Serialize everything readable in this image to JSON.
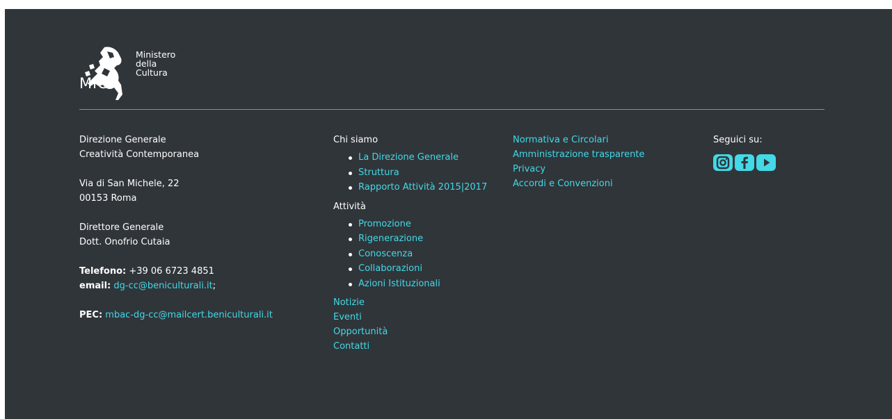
{
  "logo": {
    "abbr": "MiC",
    "words": [
      "Ministero",
      "della",
      "Cultura"
    ]
  },
  "contact": {
    "org_line1": "Direzione Generale",
    "org_line2": "Creatività Contemporanea",
    "address_line1": "Via di San Michele, 22",
    "address_line2": "00153 Roma",
    "director_title": "Direttore Generale",
    "director_name": "Dott. Onofrio Cutaia",
    "phone_label": "Telefono:",
    "phone_value": "+39 06 6723 4851",
    "email_label": "email:",
    "email_value": "dg-cc@beniculturali.it",
    "email_suffix": ";",
    "pec_label": "PEC:",
    "pec_value": "mbac-dg-cc@mailcert.beniculturali.it"
  },
  "nav": {
    "chi_siamo": {
      "title": "Chi siamo",
      "items": [
        "La Direzione Generale",
        "Struttura",
        "Rapporto Attività 2015|2017"
      ]
    },
    "attivita": {
      "title": "Attività",
      "items": [
        "Promozione",
        "Rigenerazione",
        "Conoscenza",
        "Collaborazioni",
        "Azioni Istituzionali"
      ]
    },
    "extra_links": [
      "Notizie",
      "Eventi",
      "Opportunità",
      "Contatti"
    ]
  },
  "legal_links": [
    "Normativa e Circolari",
    "Amministrazione trasparente",
    "Privacy",
    "Accordi e Convenzioni"
  ],
  "social": {
    "title": "Seguici su:",
    "icons": [
      "instagram-icon",
      "facebook-icon",
      "youtube-icon"
    ],
    "color": "#43d9e6"
  },
  "colors": {
    "background": "#30353a",
    "link": "#43d9e6",
    "text": "#ffffff"
  }
}
